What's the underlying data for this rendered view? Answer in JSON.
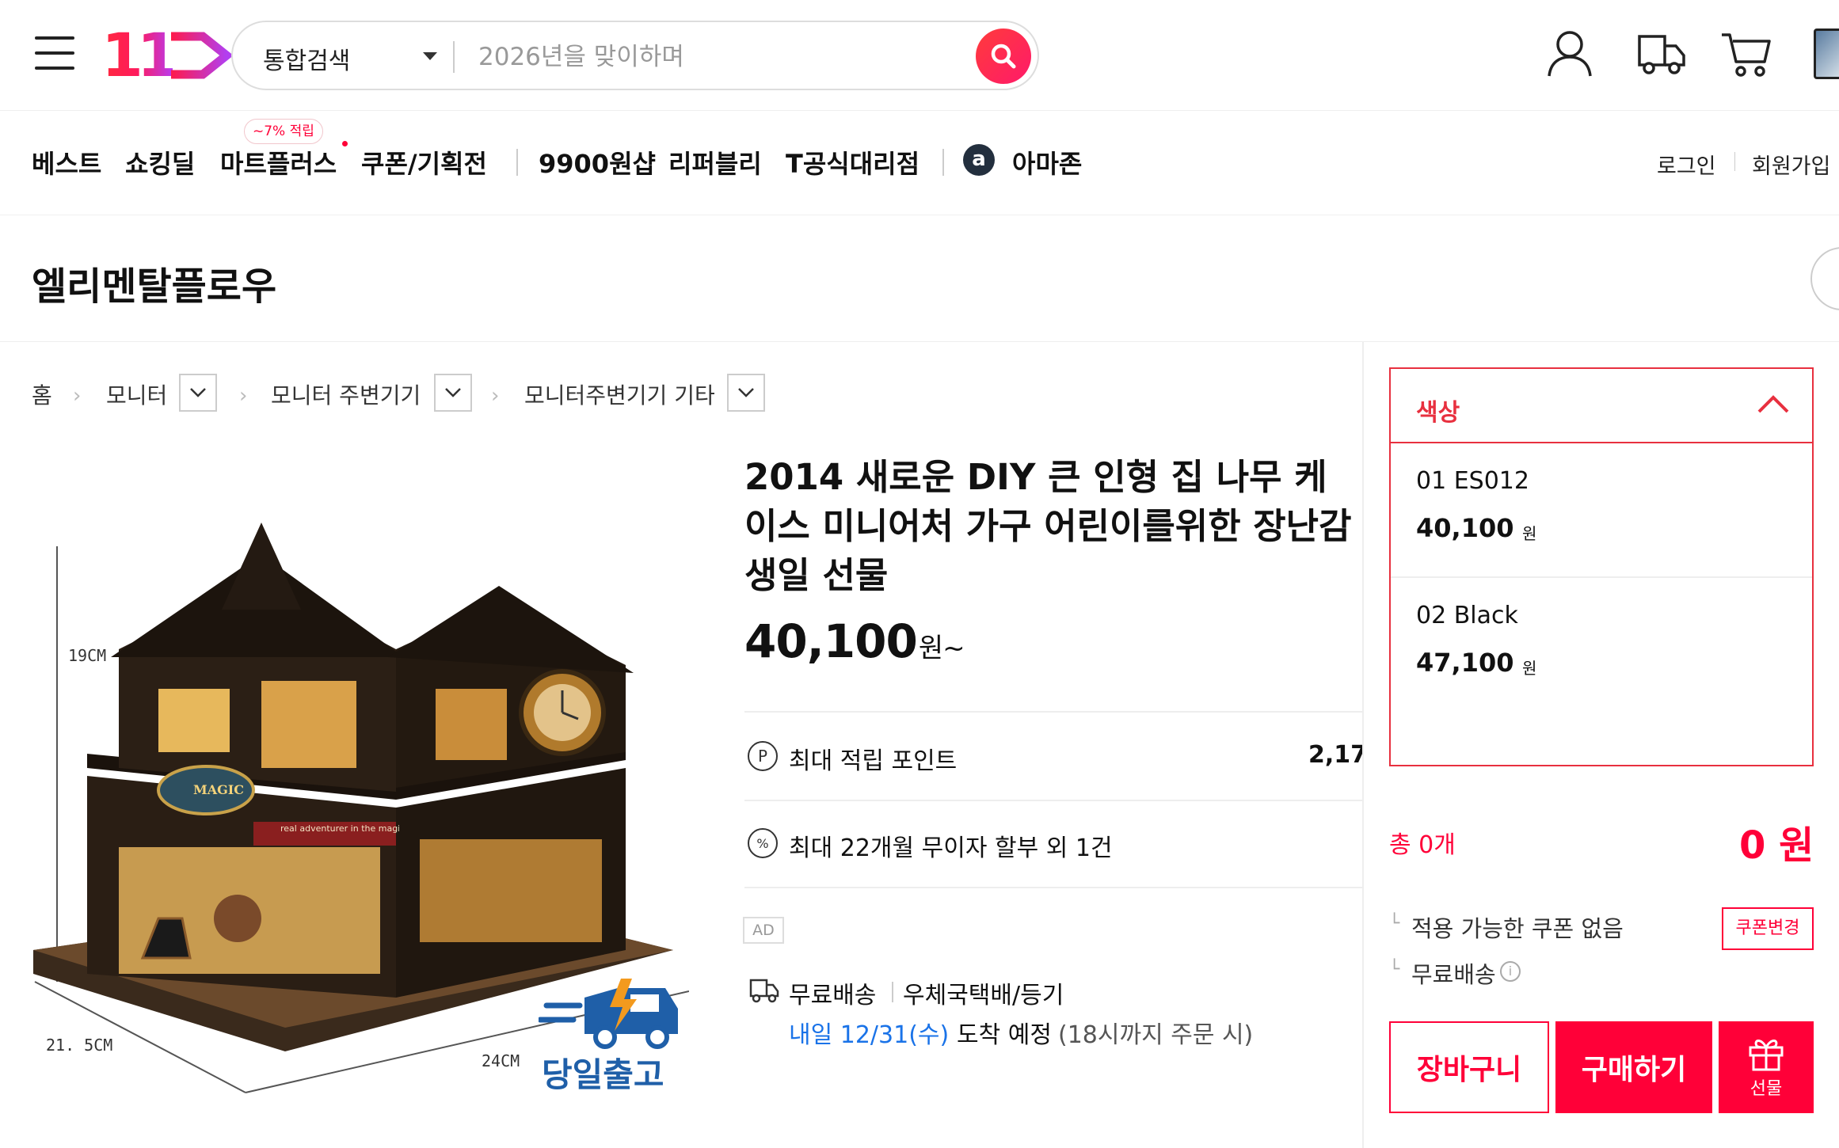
{
  "header": {
    "logo_text": "11",
    "search": {
      "category": "통합검색",
      "placeholder": "2026년을 맞이하며"
    },
    "icons": [
      "menu-icon",
      "user-icon",
      "delivery-truck-icon",
      "cart-icon",
      "profile-thumbnail"
    ]
  },
  "nav": {
    "items": [
      "베스트",
      "쇼킹딜",
      "마트플러스",
      "쿠폰/기획전",
      "9900원샵",
      "리퍼블리",
      "T공식대리점",
      "아마존"
    ],
    "mart_badge": "~7% 적립",
    "amazon_letter": "a",
    "login": "로그인",
    "signup": "회원가입"
  },
  "store": {
    "name": "엘리멘탈플로우"
  },
  "breadcrumb": {
    "home": "홈",
    "levels": [
      "모니터",
      "모니터 주변기기",
      "모니터주변기기 기타"
    ]
  },
  "product": {
    "title": "2014 새로운 DIY 큰 인형 집 나무 케이스 미니어처 가구 어린이를위한 장난감 생일 선물",
    "price": "40,100",
    "price_unit": "원~",
    "image": {
      "dim_height": "19CM",
      "dim_depth": "21. 5CM",
      "dim_width": "24CM",
      "sign_magic": "MAGIC",
      "sign_banner": "real adventurer in the magic",
      "badge": "당일출고"
    },
    "points_icon": "P",
    "points_label": "최대 적립 포인트",
    "points_value": "2,17",
    "installment_icon": "%",
    "installment_label": "최대 22개월 무이자 할부 외 1건",
    "ad_label": "AD",
    "shipping": {
      "type": "무료배송",
      "carrier": "우체국택배/등기",
      "date": "내일 12/31(수)",
      "arrival": "도착 예정",
      "note": "(18시까지 주문 시)"
    }
  },
  "options": {
    "header": "색상",
    "items": [
      {
        "name": "01 ES012",
        "price": "40,100",
        "unit": "원"
      },
      {
        "name": "02 Black",
        "price": "47,100",
        "unit": "원"
      }
    ]
  },
  "summary": {
    "total_count": "총 0개",
    "total_price": "0 원",
    "coupon_text": "적용 가능한 쿠폰 없음",
    "coupon_button": "쿠폰변경",
    "shipping_text": "무료배송",
    "info_icon": "i",
    "tree_marker": "└",
    "cart_button": "장바구니",
    "buy_button": "구매하기",
    "gift_button": "선물"
  },
  "colors": {
    "brand": "#ff0038",
    "link_blue": "#1a73e8",
    "option_border": "#e8303f"
  }
}
